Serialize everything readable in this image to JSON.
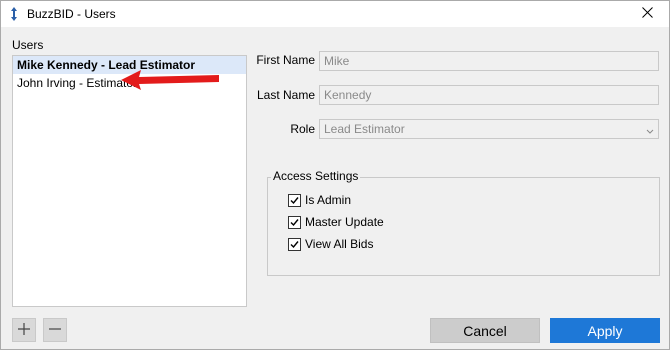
{
  "window": {
    "title": "BuzzBID - Users"
  },
  "users": {
    "label": "Users",
    "items": [
      {
        "label": "Mike Kennedy - Lead Estimator",
        "selected": true
      },
      {
        "label": "John Irving - Estimator",
        "selected": false
      }
    ]
  },
  "form": {
    "first_name_label": "First Name",
    "first_name_value": "Mike",
    "last_name_label": "Last Name",
    "last_name_value": "Kennedy",
    "role_label": "Role",
    "role_value": "Lead Estimator"
  },
  "access": {
    "legend": "Access Settings",
    "options": [
      {
        "label": "Is Admin",
        "checked": true
      },
      {
        "label": "Master Update",
        "checked": true
      },
      {
        "label": "View All Bids",
        "checked": true
      }
    ]
  },
  "buttons": {
    "cancel": "Cancel",
    "apply": "Apply"
  },
  "icons": {
    "close": "close-icon",
    "add": "plus-icon",
    "remove": "minus-icon",
    "app": "app-icon",
    "annotation": "red-arrow-icon"
  },
  "colors": {
    "accent": "#1e78d7",
    "selection": "#dce8f9",
    "annotation": "#e31b1b"
  }
}
